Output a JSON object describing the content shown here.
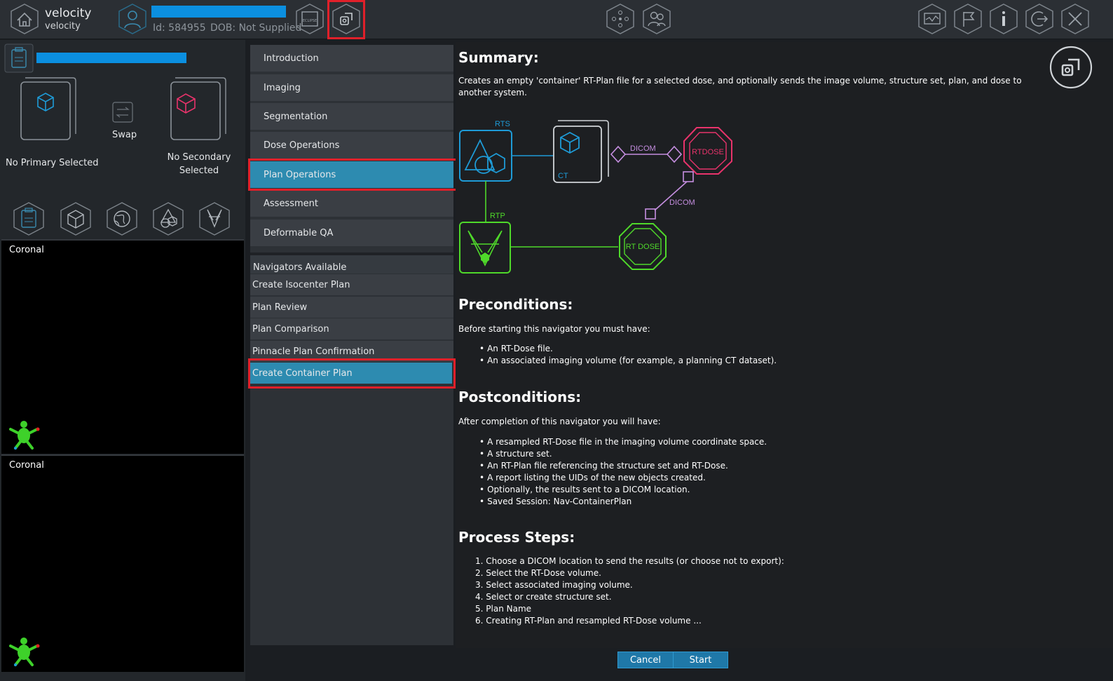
{
  "app": {
    "brand_title": "velocity",
    "brand_subtitle": "velocity"
  },
  "patient": {
    "id_text": "Id: 584955",
    "dob_text": "DOB: Not Supplied"
  },
  "top_icons": [
    "home-icon",
    "patient-icon",
    "eclipse-icon",
    "navigator-icon",
    "registration-icon",
    "users-icon",
    "monitor-icon",
    "flag-icon",
    "info-icon",
    "logout-icon",
    "close-icon"
  ],
  "eclipse_label": "ECLIPSE",
  "left": {
    "no_primary": "No Primary Selected",
    "swap": "Swap",
    "no_secondary": "No Secondary Selected",
    "viewports": [
      "Coronal",
      "Coronal"
    ]
  },
  "menu": {
    "items": [
      "Introduction",
      "Imaging",
      "Segmentation",
      "Dose Operations",
      "Plan Operations",
      "Assessment",
      "Deformable QA"
    ],
    "active": "Plan Operations"
  },
  "navigators": {
    "header": "Navigators Available",
    "items": [
      "Create Isocenter Plan",
      "Plan Review",
      "Plan Comparison",
      "Pinnacle Plan Confirmation",
      "Create Container Plan"
    ],
    "active": "Create Container Plan"
  },
  "content": {
    "summary_title": "Summary:",
    "summary_text": "Creates an empty 'container' RT-Plan file for a selected dose, and optionally sends the image volume, structure set, plan, and dose to another system.",
    "preconditions_title": "Preconditions:",
    "preconditions_intro": "Before starting this navigator you must have:",
    "preconditions": [
      "An RT-Dose file.",
      "An associated imaging volume (for example, a planning CT dataset)."
    ],
    "postconditions_title": "Postconditions:",
    "postconditions_intro": "After completion of this navigator you will have:",
    "postconditions": [
      "A resampled RT-Dose file in the imaging volume coordinate space.",
      "A structure set.",
      "An RT-Plan file referencing the structure set and RT-Dose.",
      "A report listing the UIDs of the new objects created.",
      "Optionally, the results sent to a DICOM location.",
      "Saved Session: Nav-ContainerPlan"
    ],
    "steps_title": "Process Steps:",
    "steps": [
      "1. Choose a DICOM location to send the results (or choose not to export):",
      "2. Select the RT-Dose volume.",
      "3. Select associated imaging volume.",
      "4. Select or create structure set.",
      "5. Plan Name",
      "6. Creating RT-Plan and resampled RT-Dose volume ..."
    ]
  },
  "diagram": {
    "rts": "RTS",
    "ct": "CT",
    "dicom1": "DICOM",
    "rtdose_top": "RTDOSE",
    "dicom2": "DICOM",
    "rtp": "RTP",
    "rtdose_bottom": "RT DOSE",
    "colors": {
      "blue": "#1e9bd7",
      "pink": "#e8336b",
      "violet": "#c58ee0",
      "green": "#4fd92a"
    }
  },
  "footer": {
    "cancel": "Cancel",
    "start": "Start"
  }
}
